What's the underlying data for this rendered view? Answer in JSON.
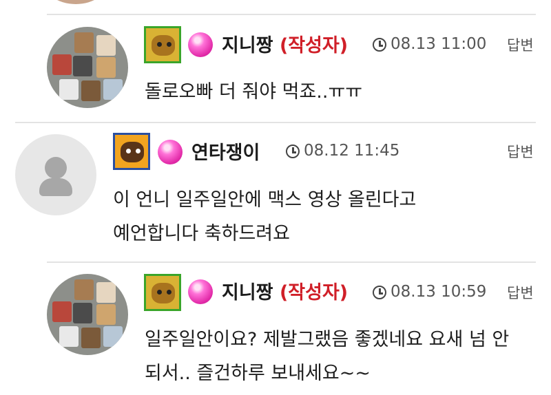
{
  "comments": [
    {
      "user": "지니짱",
      "author_tag": "(작성자)",
      "time": "08.13 11:00",
      "reply": "답변",
      "lines": [
        "돌로오빠 더 줘야 먹죠..ㅠㅠ"
      ]
    },
    {
      "user": "연타쟁이",
      "author_tag": "",
      "time": "08.12 11:45",
      "reply": "답변",
      "lines": [
        "이 언니 일주일안에 맥스 영상 올린다고",
        "예언합니다 축하드려요"
      ]
    },
    {
      "user": "지니짱",
      "author_tag": "(작성자)",
      "time": "08.13 10:59",
      "reply": "답변",
      "lines": [
        "일주일안이요? 제발그랬음 좋겠네요 요새 넘 안",
        "되서..  즐건하루 보내세요~~"
      ]
    }
  ]
}
